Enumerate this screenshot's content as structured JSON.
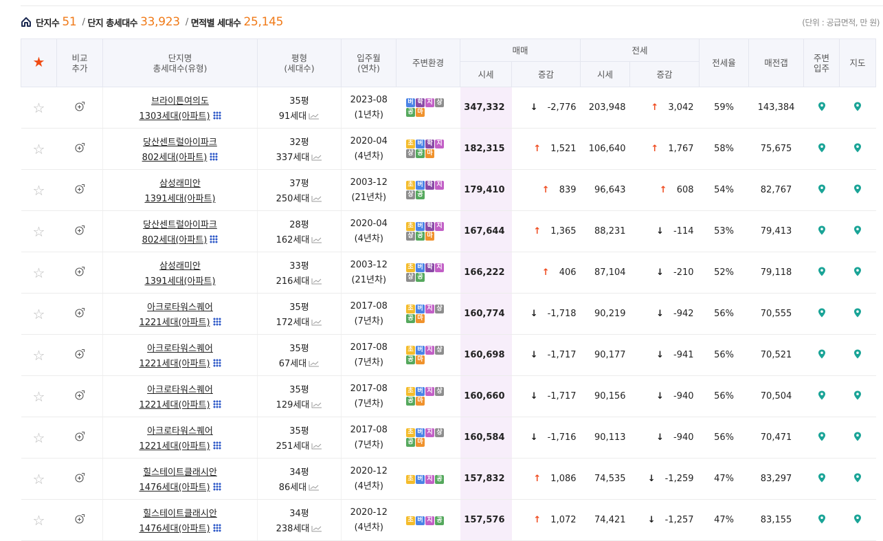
{
  "summary": {
    "complex_label": "단지수",
    "complex_count": "51",
    "total_label": "단지 총세대수",
    "total_count": "33,923",
    "area_label": "면적별 세대수",
    "area_count": "25,145",
    "separator": "/",
    "unit_note": "(단위 : 공급면적, 만 원)"
  },
  "headers": {
    "compare_1": "비교",
    "compare_2": "추가",
    "name_1": "단지명",
    "name_2": "총세대수(유형)",
    "py_1": "평형",
    "py_2": "(세대수)",
    "move_1": "입주월",
    "move_2": "(연차)",
    "env": "주변환경",
    "sale": "매매",
    "jeonse": "전세",
    "price": "시세",
    "change": "증감",
    "ratio": "전세율",
    "gap": "매전갭",
    "nearby_1": "주변",
    "nearby_2": "입주",
    "map": "지도"
  },
  "colors": {
    "accent": "#f07a18",
    "sale_bg": "#f7eefa",
    "up": "#ef4b1f",
    "down": "#1b1b1b",
    "pin": "#1aa497"
  },
  "icons": {
    "house": "home-icon",
    "star": "star-icon",
    "compare": "compare-add-icon",
    "grid": "grid-icon",
    "trend": "trend-icon",
    "pin": "map-pin-icon"
  },
  "rows": [
    {
      "name": "브라이튼여의도",
      "units": "1303세대(아파트)",
      "grid": true,
      "py": "35평",
      "py_units": "91세대",
      "move": "2023-08",
      "age": "(1년차)",
      "env": [
        [
          "버",
          "bus"
        ],
        [
          "학",
          "hak"
        ],
        [
          "지",
          "ji"
        ],
        [
          "상",
          "sang"
        ],
        [
          "공",
          "gong"
        ],
        [
          "마",
          "ma"
        ]
      ],
      "sale": "347,332",
      "sale_dir": "down",
      "sale_chg": "-2,776",
      "jeonse": "203,948",
      "j_dir": "up",
      "j_chg": "3,042",
      "ratio": "59%",
      "gap": "143,384"
    },
    {
      "name": "당산센트럴아이파크",
      "units": "802세대(아파트)",
      "grid": true,
      "py": "32평",
      "py_units": "337세대",
      "move": "2020-04",
      "age": "(4년차)",
      "env": [
        [
          "초",
          "cho"
        ],
        [
          "버",
          "bus"
        ],
        [
          "학",
          "hak"
        ],
        [
          "지",
          "ji"
        ],
        [
          "상",
          "sang"
        ],
        [
          "공",
          "gong"
        ],
        [
          "마",
          "ma"
        ]
      ],
      "sale": "182,315",
      "sale_dir": "up",
      "sale_chg": "1,521",
      "jeonse": "106,640",
      "j_dir": "up",
      "j_chg": "1,767",
      "ratio": "58%",
      "gap": "75,675"
    },
    {
      "name": "삼성래미안",
      "units": "1391세대(아파트)",
      "grid": false,
      "py": "37평",
      "py_units": "250세대",
      "move": "2003-12",
      "age": "(21년차)",
      "env": [
        [
          "초",
          "cho"
        ],
        [
          "버",
          "bus"
        ],
        [
          "학",
          "hak"
        ],
        [
          "지",
          "ji"
        ],
        [
          "상",
          "sang"
        ],
        [
          "공",
          "gong"
        ]
      ],
      "sale": "179,410",
      "sale_dir": "up",
      "sale_chg": "839",
      "jeonse": "96,643",
      "j_dir": "up",
      "j_chg": "608",
      "ratio": "54%",
      "gap": "82,767"
    },
    {
      "name": "당산센트럴아이파크",
      "units": "802세대(아파트)",
      "grid": true,
      "py": "28평",
      "py_units": "162세대",
      "move": "2020-04",
      "age": "(4년차)",
      "env": [
        [
          "초",
          "cho"
        ],
        [
          "버",
          "bus"
        ],
        [
          "학",
          "hak"
        ],
        [
          "지",
          "ji"
        ],
        [
          "상",
          "sang"
        ],
        [
          "공",
          "gong"
        ],
        [
          "마",
          "ma"
        ]
      ],
      "sale": "167,644",
      "sale_dir": "up",
      "sale_chg": "1,365",
      "jeonse": "88,231",
      "j_dir": "down",
      "j_chg": "-114",
      "ratio": "53%",
      "gap": "79,413"
    },
    {
      "name": "삼성래미안",
      "units": "1391세대(아파트)",
      "grid": false,
      "py": "33평",
      "py_units": "216세대",
      "move": "2003-12",
      "age": "(21년차)",
      "env": [
        [
          "초",
          "cho"
        ],
        [
          "버",
          "bus"
        ],
        [
          "학",
          "hak"
        ],
        [
          "지",
          "ji"
        ],
        [
          "상",
          "sang"
        ],
        [
          "공",
          "gong"
        ]
      ],
      "sale": "166,222",
      "sale_dir": "up",
      "sale_chg": "406",
      "jeonse": "87,104",
      "j_dir": "down",
      "j_chg": "-210",
      "ratio": "52%",
      "gap": "79,118"
    },
    {
      "name": "아크로타워스퀘어",
      "units": "1221세대(아파트)",
      "grid": true,
      "py": "35평",
      "py_units": "172세대",
      "move": "2017-08",
      "age": "(7년차)",
      "env": [
        [
          "초",
          "cho"
        ],
        [
          "버",
          "bus"
        ],
        [
          "지",
          "ji"
        ],
        [
          "상",
          "sang"
        ],
        [
          "공",
          "gong"
        ],
        [
          "마",
          "ma"
        ]
      ],
      "sale": "160,774",
      "sale_dir": "down",
      "sale_chg": "-1,718",
      "jeonse": "90,219",
      "j_dir": "down",
      "j_chg": "-942",
      "ratio": "56%",
      "gap": "70,555"
    },
    {
      "name": "아크로타워스퀘어",
      "units": "1221세대(아파트)",
      "grid": true,
      "py": "35평",
      "py_units": "67세대",
      "move": "2017-08",
      "age": "(7년차)",
      "env": [
        [
          "초",
          "cho"
        ],
        [
          "버",
          "bus"
        ],
        [
          "지",
          "ji"
        ],
        [
          "상",
          "sang"
        ],
        [
          "공",
          "gong"
        ],
        [
          "마",
          "ma"
        ]
      ],
      "sale": "160,698",
      "sale_dir": "down",
      "sale_chg": "-1,717",
      "jeonse": "90,177",
      "j_dir": "down",
      "j_chg": "-941",
      "ratio": "56%",
      "gap": "70,521"
    },
    {
      "name": "아크로타워스퀘어",
      "units": "1221세대(아파트)",
      "grid": true,
      "py": "35평",
      "py_units": "129세대",
      "move": "2017-08",
      "age": "(7년차)",
      "env": [
        [
          "초",
          "cho"
        ],
        [
          "버",
          "bus"
        ],
        [
          "지",
          "ji"
        ],
        [
          "상",
          "sang"
        ],
        [
          "공",
          "gong"
        ],
        [
          "마",
          "ma"
        ]
      ],
      "sale": "160,660",
      "sale_dir": "down",
      "sale_chg": "-1,717",
      "jeonse": "90,156",
      "j_dir": "down",
      "j_chg": "-940",
      "ratio": "56%",
      "gap": "70,504"
    },
    {
      "name": "아크로타워스퀘어",
      "units": "1221세대(아파트)",
      "grid": true,
      "py": "35평",
      "py_units": "251세대",
      "move": "2017-08",
      "age": "(7년차)",
      "env": [
        [
          "초",
          "cho"
        ],
        [
          "버",
          "bus"
        ],
        [
          "지",
          "ji"
        ],
        [
          "상",
          "sang"
        ],
        [
          "공",
          "gong"
        ],
        [
          "마",
          "ma"
        ]
      ],
      "sale": "160,584",
      "sale_dir": "down",
      "sale_chg": "-1,716",
      "jeonse": "90,113",
      "j_dir": "down",
      "j_chg": "-940",
      "ratio": "56%",
      "gap": "70,471"
    },
    {
      "name": "힐스테이트클래시안",
      "units": "1476세대(아파트)",
      "grid": true,
      "py": "34평",
      "py_units": "86세대",
      "move": "2020-12",
      "age": "(4년차)",
      "env": [
        [
          "초",
          "cho"
        ],
        [
          "버",
          "bus"
        ],
        [
          "지",
          "ji"
        ],
        [
          "공",
          "gong"
        ]
      ],
      "sale": "157,832",
      "sale_dir": "up",
      "sale_chg": "1,086",
      "jeonse": "74,535",
      "j_dir": "down",
      "j_chg": "-1,259",
      "ratio": "47%",
      "gap": "83,297"
    },
    {
      "name": "힐스테이트클래시안",
      "units": "1476세대(아파트)",
      "grid": true,
      "py": "34평",
      "py_units": "238세대",
      "move": "2020-12",
      "age": "(4년차)",
      "env": [
        [
          "초",
          "cho"
        ],
        [
          "버",
          "bus"
        ],
        [
          "지",
          "ji"
        ],
        [
          "공",
          "gong"
        ]
      ],
      "sale": "157,576",
      "sale_dir": "up",
      "sale_chg": "1,072",
      "jeonse": "74,421",
      "j_dir": "down",
      "j_chg": "-1,257",
      "ratio": "47%",
      "gap": "83,155"
    }
  ]
}
